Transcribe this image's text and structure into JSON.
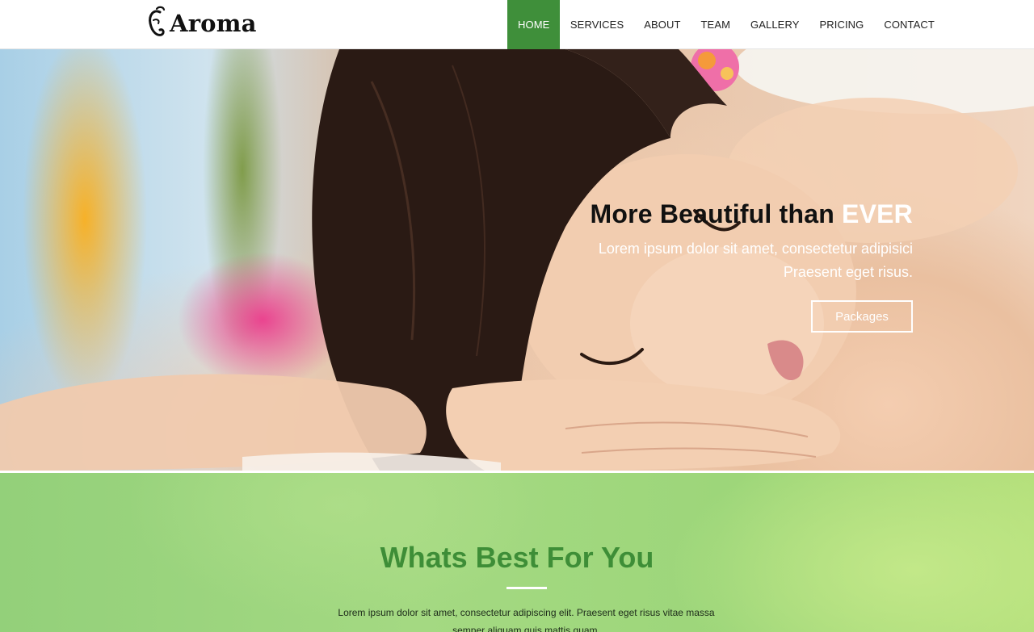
{
  "header": {
    "logo_text": "Aroma",
    "nav": [
      {
        "label": "HOME",
        "active": true
      },
      {
        "label": "SERVICES",
        "active": false
      },
      {
        "label": "ABOUT",
        "active": false
      },
      {
        "label": "TEAM",
        "active": false
      },
      {
        "label": "GALLERY",
        "active": false
      },
      {
        "label": "PRICING",
        "active": false
      },
      {
        "label": "CONTACT",
        "active": false
      }
    ]
  },
  "hero": {
    "title_main": "More Beautiful than ",
    "title_accent": "EVER",
    "subtitle": "Lorem ipsum dolor sit amet, consectetur adipisici Praesent eget risus.",
    "button_label": "Packages"
  },
  "section": {
    "title": "Whats Best For You",
    "text": "Lorem ipsum dolor sit amet, consectetur adipiscing elit. Praesent eget risus vitae massa semper aliquam quis mattis quam."
  },
  "colors": {
    "brand_green": "#3f8f3a",
    "title_green": "#3e8e37",
    "section_bg": "#a4d982"
  },
  "icons": {
    "logo": "swirl-letter-icon"
  }
}
